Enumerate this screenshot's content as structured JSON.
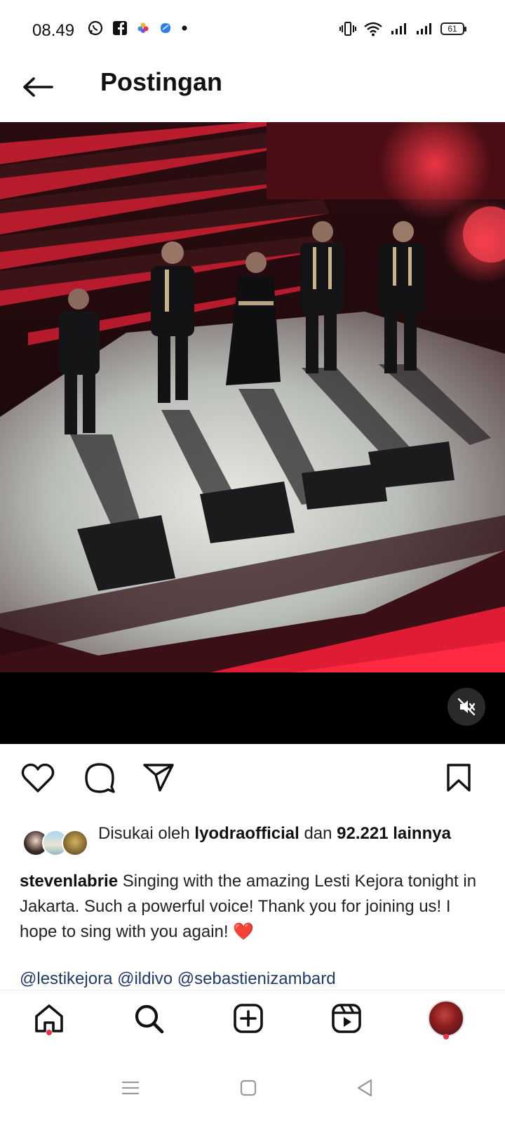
{
  "status_bar": {
    "time": "08.49",
    "left_icons": [
      "whatsapp-icon",
      "facebook-icon",
      "app-flower-icon",
      "app-blue-icon",
      "dot-icon"
    ],
    "right_icons": [
      "vibrate-icon",
      "wifi-icon",
      "signal-icon",
      "signal-icon",
      "battery-icon"
    ],
    "battery_level": "61"
  },
  "header": {
    "back_icon": "arrow-left-icon",
    "title": "Postingan"
  },
  "media": {
    "kind": "video",
    "mute_icon": "muted-speaker-icon"
  },
  "actions": {
    "like_icon": "heart-icon",
    "comment_icon": "comment-icon",
    "share_icon": "send-icon",
    "save_icon": "bookmark-icon"
  },
  "likes": {
    "prefix": "Disukai oleh",
    "user": "lyodraofficial",
    "conjunction": "dan",
    "count": "92.221",
    "suffix": "lainnya"
  },
  "caption": {
    "username": "stevenlabrie",
    "text": "Singing with the amazing Lesti Kejora tonight in Jakarta. Such a powerful voice! Thank you for joining us! I hope to sing with you again!",
    "emoji": "❤️",
    "mentions": "@lestikejora @ildivo @sebastienizambard"
  },
  "bottom_nav": {
    "items": [
      "home-icon",
      "search-icon",
      "create-post-icon",
      "reels-icon",
      "profile-avatar"
    ],
    "accent": "#e8334a"
  },
  "system_nav": {
    "items": [
      "menu-icon",
      "home-square-icon",
      "back-triangle-icon"
    ]
  }
}
